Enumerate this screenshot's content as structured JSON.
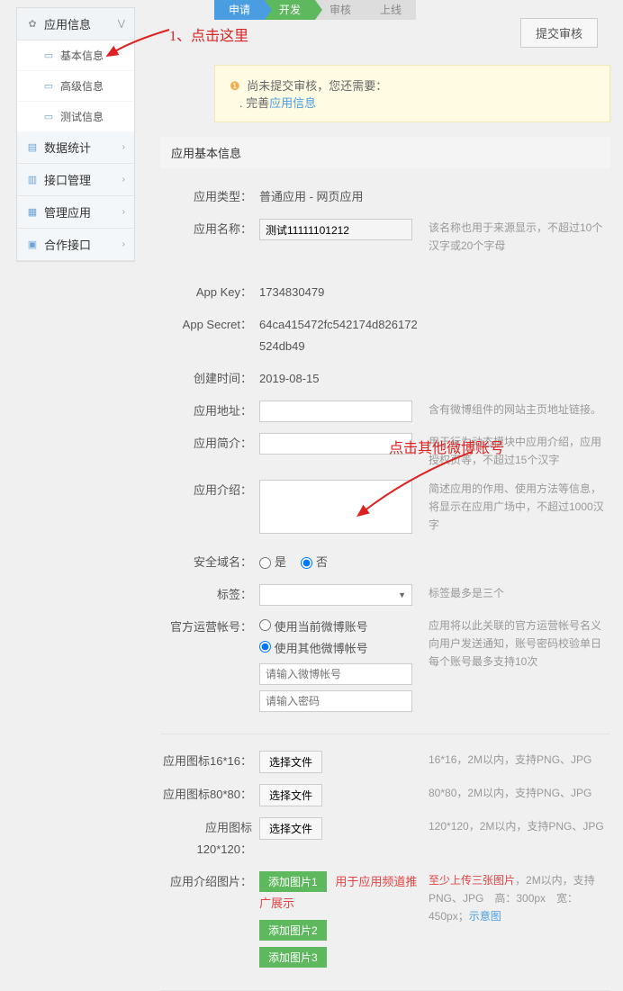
{
  "annotations": {
    "a1": "1、点击这里",
    "a2": "点击其他微博账号"
  },
  "sidebar": {
    "app_info": "应用信息",
    "basic_info": "基本信息",
    "adv_info": "高级信息",
    "test_info": "测试信息",
    "stats": "数据统计",
    "api_mgmt": "接口管理",
    "app_mgmt": "管理应用",
    "coop_api": "合作接口"
  },
  "steps": {
    "s1": "申请",
    "s2": "开发",
    "s3": "审核",
    "s4": "上线"
  },
  "submit_label": "提交审核",
  "alert": {
    "prefix": "尚未提交审核，您还需要：",
    "dot": ".",
    "action": "完善",
    "link": "应用信息"
  },
  "panel_title": "应用基本信息",
  "fields": {
    "app_type": {
      "label": "应用类型：",
      "value": "普通应用  -  网页应用"
    },
    "app_name": {
      "label": "应用名称：",
      "value": "测试11111101212",
      "hint": "该名称也用于来源显示，不超过10个汉字或20个字母"
    },
    "app_key": {
      "label": "App Key：",
      "value": "1734830479"
    },
    "app_secret": {
      "label": "App Secret：",
      "value": "64ca415472fc542174d826172524db49"
    },
    "create_time": {
      "label": "创建时间：",
      "value": "2019-08-15"
    },
    "app_addr": {
      "label": "应用地址：",
      "hint": "含有微博组件的网站主页地址链接。"
    },
    "app_intro": {
      "label": "应用简介：",
      "hint": "用于行为动态模块中应用介绍，应用授权页等，不超过15个汉字"
    },
    "app_desc": {
      "label": "应用介绍：",
      "hint": "简述应用的作用、使用方法等信息，将显示在应用广场中，不超过1000汉字"
    },
    "safe_domain": {
      "label": "安全域名：",
      "yes": "是",
      "no": "否"
    },
    "tags": {
      "label": "标签：",
      "hint": "标签最多是三个"
    },
    "op_account": {
      "label": "官方运营帐号：",
      "opt1": "使用当前微博账号",
      "opt2": "使用其他微博帐号",
      "hint": "应用将以此关联的官方运营帐号名义向用户发送通知，账号密码校验单日每个账号最多支持10次",
      "ph_user": "请输入微博帐号",
      "ph_pwd": "请输入密码"
    },
    "icon16": {
      "label": "应用图标16*16：",
      "btn": "选择文件",
      "hint": "16*16，2M以内，支持PNG、JPG"
    },
    "icon80": {
      "label": "应用图标80*80：",
      "btn": "选择文件",
      "hint": "80*80，2M以内，支持PNG、JPG"
    },
    "icon120": {
      "label": "应用图标120*120：",
      "btn": "选择文件",
      "hint": "120*120，2M以内，支持PNG、JPG"
    },
    "intro_img": {
      "label": "应用介绍图片：",
      "btn1": "添加图片1",
      "btn2": "添加图片2",
      "btn3": "添加图片3",
      "red": "用于应用频道推广展示",
      "hint_pre": "至少上传三张图片",
      "hint_post": "，2M以内，支持PNG、JPG　高：300px　宽：450px；",
      "example": "示意图"
    }
  }
}
